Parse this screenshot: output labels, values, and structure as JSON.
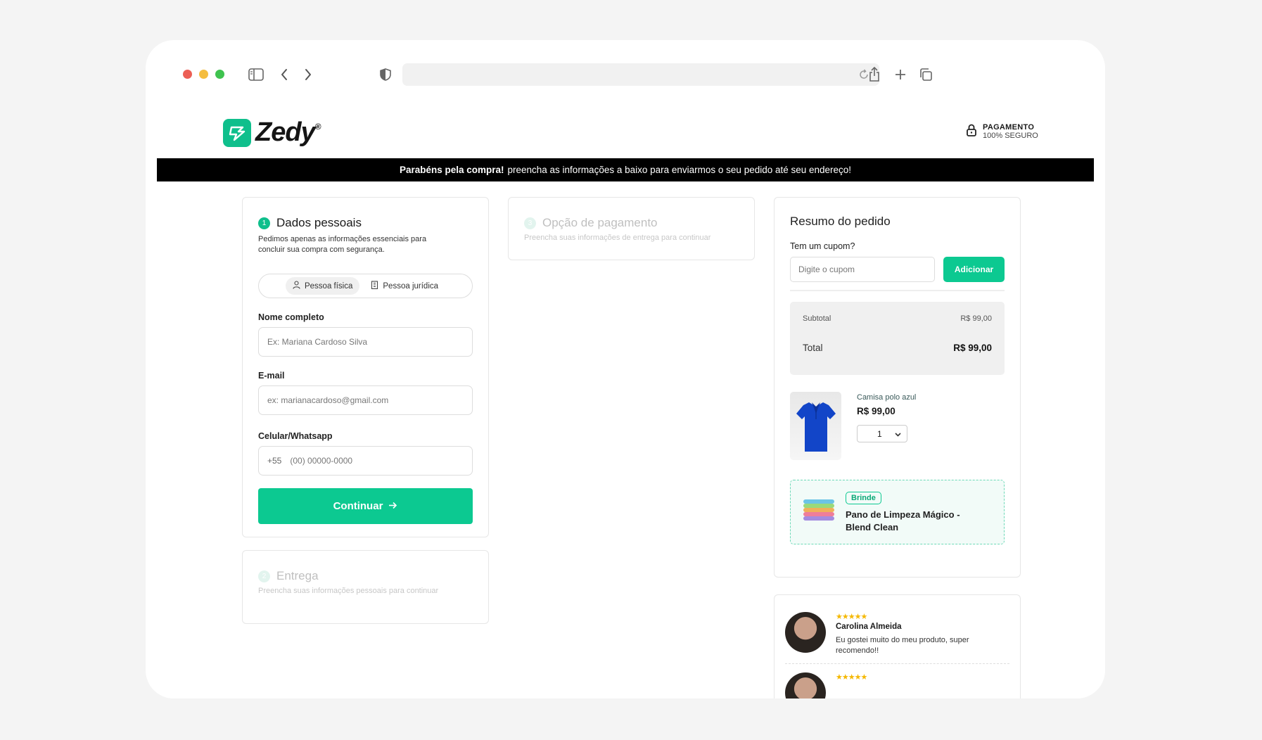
{
  "browser": {
    "traffic_lights": [
      "#ec5f55",
      "#f4bd3f",
      "#3fc34f"
    ],
    "icons": [
      "sidebar-icon",
      "back-icon",
      "forward-icon",
      "shield-icon",
      "reload-icon",
      "share-icon",
      "new-tab-icon",
      "tabs-icon"
    ]
  },
  "header": {
    "brand": "Zedy",
    "brand_mark": "®",
    "secure_line1": "PAGAMENTO",
    "secure_line2": "100% SEGURO"
  },
  "banner": {
    "bold": "Parabéns pela compra!",
    "text": "preencha as informações a baixo para enviarmos o seu pedido até seu endereço!"
  },
  "personal": {
    "step": "1",
    "title": "Dados pessoais",
    "subtitle": "Pedimos apenas as informações essenciais para concluir sua compra com segurança.",
    "toggle_fisica": "Pessoa física",
    "toggle_juridica": "Pessoa jurídica",
    "name_label": "Nome completo",
    "name_placeholder": "Ex: Mariana Cardoso Silva",
    "email_label": "E-mail",
    "email_placeholder": "ex: marianacardoso@gmail.com",
    "phone_label": "Celular/Whatsapp",
    "phone_ddi": "+55",
    "phone_placeholder": "(00) 00000-0000",
    "continue": "Continuar"
  },
  "delivery": {
    "step": "2",
    "title": "Entrega",
    "subtitle": "Preencha suas informações pessoais para continuar"
  },
  "payment": {
    "step": "3",
    "title": "Opção de pagamento",
    "subtitle": "Preencha suas informações de entrega para continuar"
  },
  "summary": {
    "title": "Resumo do pedido",
    "coupon_label": "Tem um cupom?",
    "coupon_placeholder": "Digite o cupom",
    "coupon_button": "Adicionar",
    "subtotal_label": "Subtotal",
    "subtotal_value": "R$ 99,00",
    "total_label": "Total",
    "total_value": "R$ 99,00",
    "product_name": "Camisa polo azul",
    "product_price": "R$ 99,00",
    "quantity": "1",
    "gift_badge": "Brinde",
    "gift_name": "Pano de Limpeza Mágico - Blend Clean"
  },
  "reviews": [
    {
      "stars": "★★★★★",
      "name": "Carolina Almeida",
      "text": "Eu gostei muito do meu produto, super recomendo!!"
    },
    {
      "stars": "★★★★★"
    }
  ]
}
